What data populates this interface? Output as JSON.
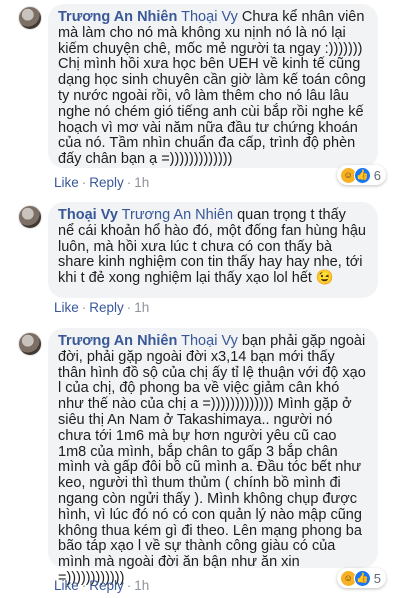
{
  "comments": [
    {
      "author": "Trương An Nhiên",
      "tagged": "Thoại Vy",
      "text": " Chưa kể nhân viên mà làm cho nó mà không xu nịnh nó là nó lại kiếm chuyện chê, mốc mẻ người ta ngay :))))))) Chị mình hồi xưa học bên UEH về kinh tế cũng dạng học sinh chuyên cần giờ làm kế toán công ty nước ngoài rồi, vô làm thêm cho nó lâu lâu nghe nó chém gió tiếng anh cùi bắp rồi nghe kế hoạch vì mơ vài năm nữa đầu tư chứng khoán của nó. Tầm nhìn chuẩn đa cấp, trình độ phèn đấy chân bạn ạ =)))))))))))))",
      "reaction_icons": [
        "like",
        "haha"
      ],
      "reaction_count": "6",
      "like_label": "Like",
      "reply_label": "Reply",
      "time": "1h"
    },
    {
      "author": "Thoại Vy",
      "tagged": "Trương An Nhiên",
      "text": " quan trọng t thấy nể cái khoản hổ hào đó, một đống fan hùng hậu luôn, mà hồi xưa lúc t chưa có con thấy bà share kinh nghiệm con tin thấy hay hay nhe, tới khi t đẻ xong nghiệm lại thấy xạo lol hết 😉",
      "reaction_icons": [],
      "reaction_count": "",
      "like_label": "Like",
      "reply_label": "Reply",
      "time": "1h"
    },
    {
      "author": "Trương An Nhiên",
      "tagged": "Thoại Vy",
      "text": " bạn phải gặp ngoài đời, phải gặp ngoài đời x3,14 bạn mới thấy thân hình đồ sộ của chị ấy tỉ lệ thuận với độ xạo l của chị, độ phong ba về việc giảm cân khó như thế nào của chị a =))))))))))))) Mình gặp ở siêu thị An Nam ở Takashimaya.. người nó chưa tới 1m6 mà bự hơn người yêu cũ cao 1m8 của mình, bắp chân to gấp 3 bắp chân mình và gấp đôi bồ cũ mình a. Đầu tóc bết như keo, người thì thum thủm ( chính bồ mình đi ngang còn ngửi thấy ). Mình không chụp được hình, vì lúc đó nó có con quản lý nào mập cũng không thua kém gì đi theo. Lên mạng phong ba bão táp xạo l về sự thành công giàu có của mình mà ngoài đời ăn bận như ăn xin =))))))))))))",
      "reaction_icons": [
        "haha",
        "like"
      ],
      "reaction_count": "5",
      "like_label": "Like",
      "reply_label": "Reply",
      "time": "1h"
    }
  ],
  "colors": {
    "name_link": "#385898",
    "bubble_bg": "#f2f3f5",
    "meta_gray": "#90949c",
    "like_blue": "#1877f2",
    "haha_yellow": "#f7b125"
  }
}
